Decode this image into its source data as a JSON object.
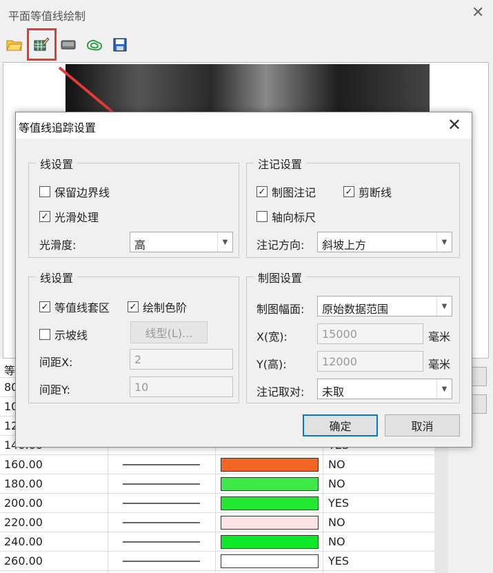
{
  "main": {
    "title": "平面等值线绘制",
    "close": "✕"
  },
  "toolbar": {
    "buttons": [
      {
        "name": "open-folder-icon",
        "glyph": "📂"
      },
      {
        "name": "contour-grid-icon",
        "glyph": "▦"
      },
      {
        "name": "display-icon",
        "glyph": "▬"
      },
      {
        "name": "contour-line-icon",
        "glyph": "◌"
      },
      {
        "name": "save-icon",
        "glyph": "💾"
      }
    ]
  },
  "dialog": {
    "title": "等值线追踪设置",
    "close": "✕",
    "line_settings_1": {
      "title": "线设置",
      "keep_boundary": {
        "label": "保留边界线",
        "checked": false
      },
      "smooth": {
        "label": "光滑处理",
        "checked": true
      },
      "smoothness_label": "光滑度:",
      "smoothness_value": "高"
    },
    "annotation_settings": {
      "title": "注记设置",
      "map_annotation": {
        "label": "制图注记",
        "checked": true
      },
      "cut_line": {
        "label": "剪断线",
        "checked": true
      },
      "axis_ruler": {
        "label": "轴向标尺",
        "checked": false
      },
      "direction_label": "注记方向:",
      "direction_value": "斜坡上方"
    },
    "line_settings_2": {
      "title": "线设置",
      "contour_zone": {
        "label": "等值线套区",
        "checked": true
      },
      "draw_color": {
        "label": "绘制色阶",
        "checked": true
      },
      "slope_line": {
        "label": "示坡线",
        "checked": false
      },
      "line_type_button": "线型(L)...",
      "spacing_x_label": "间距X:",
      "spacing_x_value": "2",
      "spacing_y_label": "间距Y:",
      "spacing_y_value": "10"
    },
    "map_settings": {
      "title": "制图设置",
      "frame_label": "制图幅面:",
      "frame_value": "原始数据范围",
      "x_label": "X(宽):",
      "x_value": "15000",
      "x_unit": "毫米",
      "y_label": "Y(高):",
      "y_value": "12000",
      "y_unit": "毫米",
      "pair_label": "注记取对:",
      "pair_value": "未取"
    },
    "ok": "确定",
    "cancel": "取消"
  },
  "table": {
    "partial_header": "等",
    "partial_rows": [
      "80",
      "10",
      "12",
      "140.00"
    ],
    "partial_flag": "YES",
    "rows": [
      {
        "value": "160.00",
        "color": "#f26522",
        "flag": "NO"
      },
      {
        "value": "180.00",
        "color": "#3ee84a",
        "flag": "NO"
      },
      {
        "value": "200.00",
        "color": "#22e832",
        "flag": "YES"
      },
      {
        "value": "220.00",
        "color": "#fde4e4",
        "flag": "NO"
      },
      {
        "value": "240.00",
        "color": "#0ee82a",
        "flag": "NO"
      },
      {
        "value": "260.00",
        "color": "#ffffff",
        "flag": "YES"
      }
    ]
  }
}
